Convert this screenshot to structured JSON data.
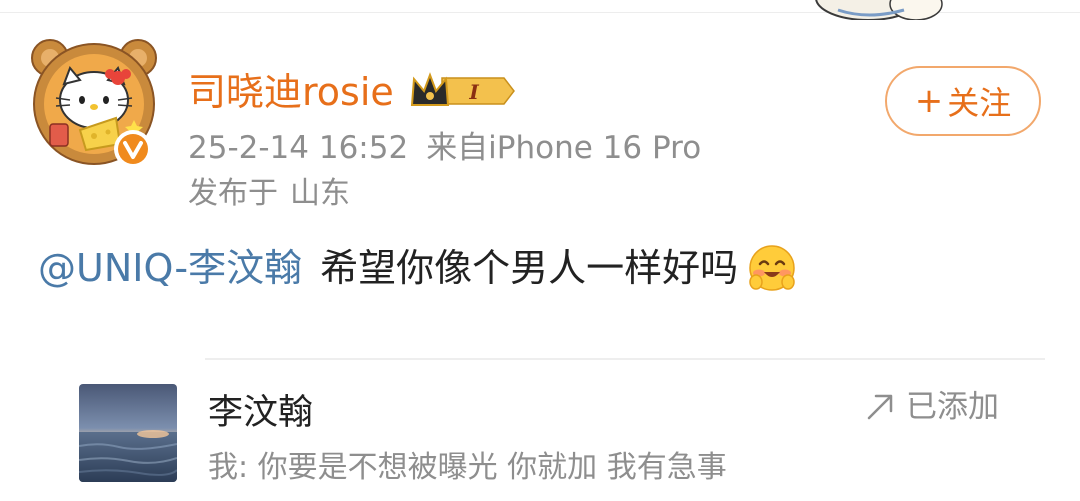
{
  "post": {
    "author": {
      "username": "司晓迪rosie",
      "avatar_icon": "hello-kitty-bear-avatar-icon",
      "verified_icon": "verified-v-badge-icon",
      "badge_icon": "vip-crown-level-badge-icon",
      "badge_text": "I"
    },
    "meta": {
      "timestamp": "25-2-14 16:52",
      "source": "来自iPhone 16 Pro",
      "location_label": "发布于",
      "location": "山东"
    },
    "follow_button": {
      "plus": "+",
      "label": "关注"
    },
    "text": {
      "mention": "@UNIQ-李汶翰",
      "body": "希望你像个男人一样好吗",
      "emoji_icon": "blushing-smile-emoji-icon"
    },
    "card": {
      "thumbnail_icon": "sea-sunset-thumbnail",
      "title": "李汶翰",
      "subtitle": "我: 你要是不想被曝光 你就加 我有急事",
      "action_label": "已添加",
      "action_icon": "arrow-up-right-icon"
    }
  },
  "colors": {
    "accent_orange": "#e76f1a",
    "follow_border": "#f2a86c",
    "mention_blue": "#4a7aa8",
    "meta_gray": "#8e8e8e",
    "text_dark": "#222222"
  }
}
